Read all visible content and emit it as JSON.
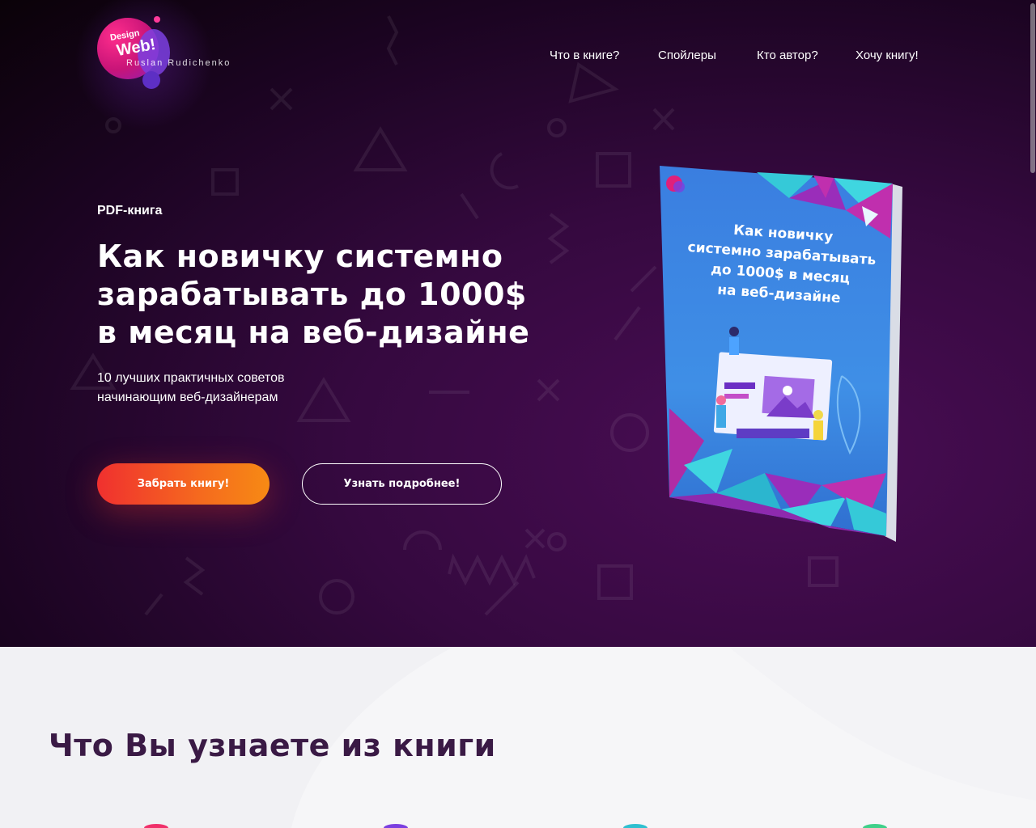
{
  "logo": {
    "design": "Design",
    "web": "Web!",
    "author": "Ruslan Rudichenko"
  },
  "nav": {
    "items": [
      {
        "label": "Что в книге?"
      },
      {
        "label": "Спойлеры"
      },
      {
        "label": "Кто автор?"
      },
      {
        "label": "Хочу книгу!"
      }
    ]
  },
  "hero": {
    "label": "PDF-книга",
    "title_line1": "Как новичку системно",
    "title_line2": "зарабатывать до 1000$",
    "title_line3": "в месяц на веб-дизайне",
    "subtitle_line1": "10 лучших практичных советов",
    "subtitle_line2": "начинающим веб-дизайнерам",
    "primary_button": "Забрать книгу!",
    "secondary_button": "Узнать подробнее!"
  },
  "book": {
    "cover_line1": "Как новичку",
    "cover_line2": "системно зарабатывать",
    "cover_line3": "до 1000$ в месяц",
    "cover_line4": "на веб-дизайне"
  },
  "section2": {
    "title": "Что Вы узнаете из книги"
  },
  "colors": {
    "hero_bg": "#35093f",
    "accent_orange": "#f56a1e",
    "accent_red": "#f0302f",
    "section_title": "#3a1a45"
  },
  "icons": [
    "triangle-shape",
    "circle-shape",
    "square-shape",
    "cross-shape",
    "wave-shape"
  ]
}
